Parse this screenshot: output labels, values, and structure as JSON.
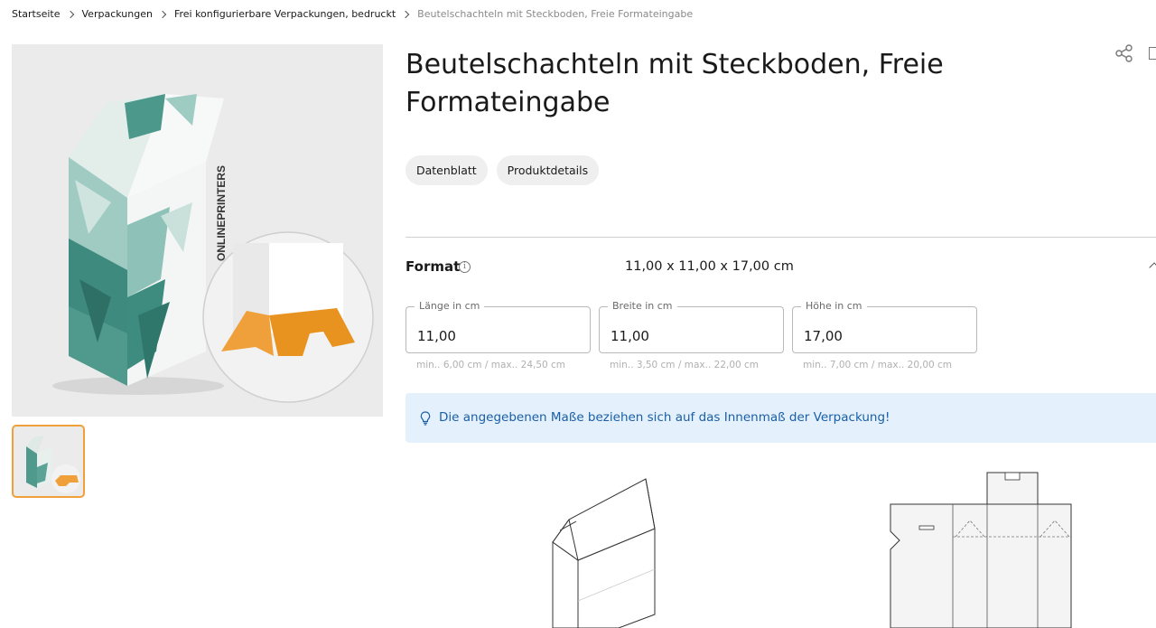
{
  "breadcrumb": [
    {
      "label": "Startseite"
    },
    {
      "label": "Verpackungen"
    },
    {
      "label": "Frei konfigurierbare Verpackungen, bedruckt"
    },
    {
      "label": "Beutelschachteln mit Steckboden, Freie Formateingabe"
    }
  ],
  "product": {
    "title": "Beutelschachteln mit Steckboden, Freie Formateingabe",
    "image_brand_text": "ONLINEPRINTERS"
  },
  "pills": [
    {
      "label": "Datenblatt"
    },
    {
      "label": "Produktdetails"
    }
  ],
  "format": {
    "label": "Format",
    "value": "11,00 x 11,00 x 17,00 cm",
    "fields": [
      {
        "label": "Länge in cm",
        "value": "11,00",
        "hint": "min.. 6,00 cm / max.. 24,50 cm"
      },
      {
        "label": "Breite in cm",
        "value": "11,00",
        "hint": "min.. 3,50 cm / max.. 22,00 cm"
      },
      {
        "label": "Höhe in cm",
        "value": "17,00",
        "hint": "min.. 7,00 cm / max.. 20,00 cm"
      }
    ]
  },
  "notice": {
    "text": "Die angegebenen Maße beziehen sich auf das Innenmaß der Verpackung!",
    "icon": "lightbulb-icon"
  },
  "colors": {
    "accent": "#f0a03a",
    "notice_bg": "#e4f0fb",
    "notice_text": "#1a5fa8",
    "teal": "#2e7f73"
  }
}
